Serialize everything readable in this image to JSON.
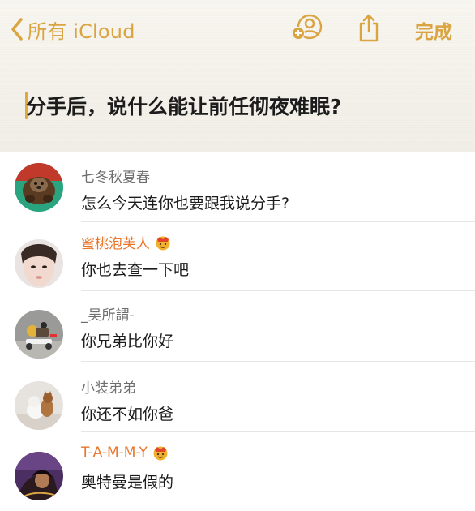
{
  "nav": {
    "back_label": "所有 iCloud",
    "done_label": "完成",
    "accent_color": "#d9a441",
    "icons": [
      "chevron-left-icon",
      "add-person-icon",
      "share-icon"
    ]
  },
  "note": {
    "title": "分手后，说什么能让前任彻夜难眠?"
  },
  "comments": [
    {
      "name": "七冬秋夏春",
      "message": "怎么今天连你也要跟我说分手?",
      "highlight": false,
      "crown": false
    },
    {
      "name": "蜜桃泡芙人",
      "message": "你也去查一下吧",
      "highlight": true,
      "crown": true
    },
    {
      "name": "_吴所謂-",
      "message": "你兄弟比你好",
      "highlight": false,
      "crown": false
    },
    {
      "name": "小装弟弟",
      "message": "你还不如你爸",
      "highlight": false,
      "crown": false
    },
    {
      "name": "T-A-M-M-Y",
      "message": "奥特曼是假的",
      "highlight": true,
      "crown": true
    }
  ]
}
